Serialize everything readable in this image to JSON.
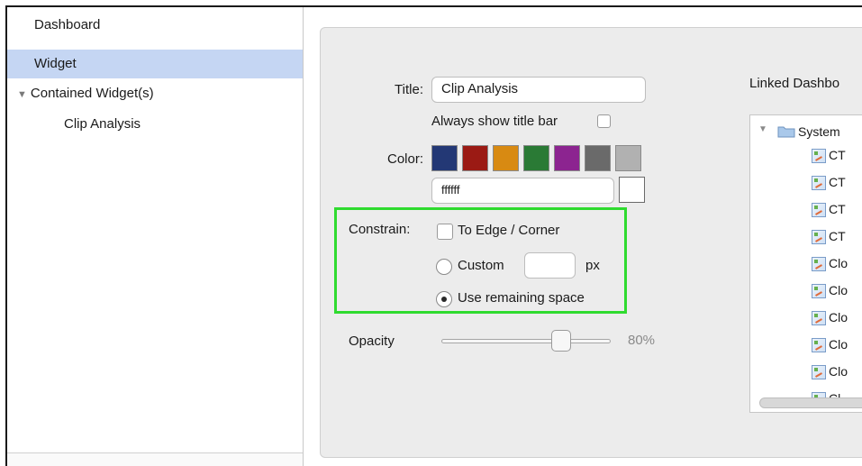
{
  "sidebar": {
    "items": [
      {
        "label": "Dashboard"
      },
      {
        "label": "Widget"
      },
      {
        "label": "Contained Widget(s)"
      },
      {
        "label": "Clip Analysis"
      }
    ]
  },
  "form": {
    "title_label": "Title:",
    "title_value": "Clip Analysis",
    "always_show_title_bar_label": "Always show title bar",
    "color_label": "Color:",
    "color_hex_value": "ffffff",
    "swatches": [
      "#233875",
      "#9b1a14",
      "#d88a12",
      "#2a7a35",
      "#8c2490",
      "#6a6a6a",
      "#b1b1b1"
    ],
    "custom_color_preview": "#ffffff",
    "constrain_label": "Constrain:",
    "to_edge_label": "To Edge / Corner",
    "custom_label": "Custom",
    "custom_unit": "px",
    "use_remaining_label": "Use remaining space",
    "opacity_label": "Opacity",
    "opacity_value_text": "80%",
    "opacity_fraction": 0.8
  },
  "linked": {
    "label": "Linked Dashbo",
    "folder_label": "System",
    "items": [
      "CT",
      "CT",
      "CT",
      "CT",
      "Clo",
      "Clo",
      "Clo",
      "Clo",
      "Clo",
      "Cl"
    ]
  },
  "colors": {
    "selection": "#c5d6f3",
    "highlight_box": "#2fdb2f"
  }
}
